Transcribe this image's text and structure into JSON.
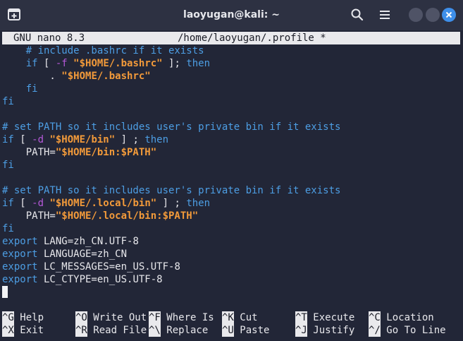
{
  "window": {
    "title": "laoyugan@kali: ~"
  },
  "icons": {
    "new_tab": "new-tab-icon",
    "search": "search-icon",
    "menu": "hamburger-menu-icon",
    "minimize": "minimize-icon",
    "maximize": "maximize-icon",
    "close": "close-icon"
  },
  "nano": {
    "version": "GNU nano 8.3",
    "filename": "/home/laoyugan/.profile *"
  },
  "lines": [
    [
      {
        "t": "    # include .bashrc if it exists",
        "c": "cm"
      }
    ],
    [
      {
        "t": "    ",
        "c": ""
      },
      {
        "t": "if",
        "c": "kw"
      },
      {
        "t": " [ ",
        "c": ""
      },
      {
        "t": "-f",
        "c": "op"
      },
      {
        "t": " ",
        "c": ""
      },
      {
        "t": "\"$HOME/.bashrc\"",
        "c": "st"
      },
      {
        "t": " ]; ",
        "c": ""
      },
      {
        "t": "then",
        "c": "kw"
      }
    ],
    [
      {
        "t": "        . ",
        "c": ""
      },
      {
        "t": "\"$HOME/.bashrc\"",
        "c": "st"
      }
    ],
    [
      {
        "t": "    ",
        "c": ""
      },
      {
        "t": "fi",
        "c": "kw"
      }
    ],
    [
      {
        "t": "fi",
        "c": "kw"
      }
    ],
    [
      {
        "t": "",
        "c": ""
      }
    ],
    [
      {
        "t": "# set PATH so it includes user's private bin if it exists",
        "c": "cm"
      }
    ],
    [
      {
        "t": "if",
        "c": "kw"
      },
      {
        "t": " [ ",
        "c": ""
      },
      {
        "t": "-d",
        "c": "op"
      },
      {
        "t": " ",
        "c": ""
      },
      {
        "t": "\"$HOME/bin\"",
        "c": "st"
      },
      {
        "t": " ] ; ",
        "c": ""
      },
      {
        "t": "then",
        "c": "kw"
      }
    ],
    [
      {
        "t": "    PATH=",
        "c": ""
      },
      {
        "t": "\"$HOME/bin:$PATH\"",
        "c": "st"
      }
    ],
    [
      {
        "t": "fi",
        "c": "kw"
      }
    ],
    [
      {
        "t": "",
        "c": ""
      }
    ],
    [
      {
        "t": "# set PATH so it includes user's private bin if it exists",
        "c": "cm"
      }
    ],
    [
      {
        "t": "if",
        "c": "kw"
      },
      {
        "t": " [ ",
        "c": ""
      },
      {
        "t": "-d",
        "c": "op"
      },
      {
        "t": " ",
        "c": ""
      },
      {
        "t": "\"$HOME/.local/bin\"",
        "c": "st"
      },
      {
        "t": " ] ; ",
        "c": ""
      },
      {
        "t": "then",
        "c": "kw"
      }
    ],
    [
      {
        "t": "    PATH=",
        "c": ""
      },
      {
        "t": "\"$HOME/.local/bin:$PATH\"",
        "c": "st"
      }
    ],
    [
      {
        "t": "fi",
        "c": "kw"
      }
    ],
    [
      {
        "t": "export",
        "c": "kw"
      },
      {
        "t": " LANG=zh_CN.UTF-8",
        "c": ""
      }
    ],
    [
      {
        "t": "export",
        "c": "kw"
      },
      {
        "t": " LANGUAGE=zh_CN",
        "c": ""
      }
    ],
    [
      {
        "t": "export",
        "c": "kw"
      },
      {
        "t": " LC_MESSAGES=en_US.UTF-8",
        "c": ""
      }
    ],
    [
      {
        "t": "export",
        "c": "kw"
      },
      {
        "t": " LC_CTYPE=en_US.UTF-8",
        "c": ""
      }
    ]
  ],
  "shortcuts_row1": [
    {
      "key": "^G",
      "label": "Help"
    },
    {
      "key": "^O",
      "label": "Write Out"
    },
    {
      "key": "^F",
      "label": "Where Is"
    },
    {
      "key": "^K",
      "label": "Cut"
    },
    {
      "key": "^T",
      "label": "Execute"
    },
    {
      "key": "^C",
      "label": "Location"
    }
  ],
  "shortcuts_row2": [
    {
      "key": "^X",
      "label": "Exit"
    },
    {
      "key": "^R",
      "label": "Read File"
    },
    {
      "key": "^\\",
      "label": "Replace"
    },
    {
      "key": "^U",
      "label": "Paste"
    },
    {
      "key": "^J",
      "label": "Justify"
    },
    {
      "key": "^/",
      "label": "Go To Line"
    }
  ],
  "colors": {
    "comment": "#4d9ee4",
    "keyword": "#4d9ee4",
    "operator": "#b458d8",
    "string": "#f29a3a",
    "close_button": "#3e8fea"
  }
}
